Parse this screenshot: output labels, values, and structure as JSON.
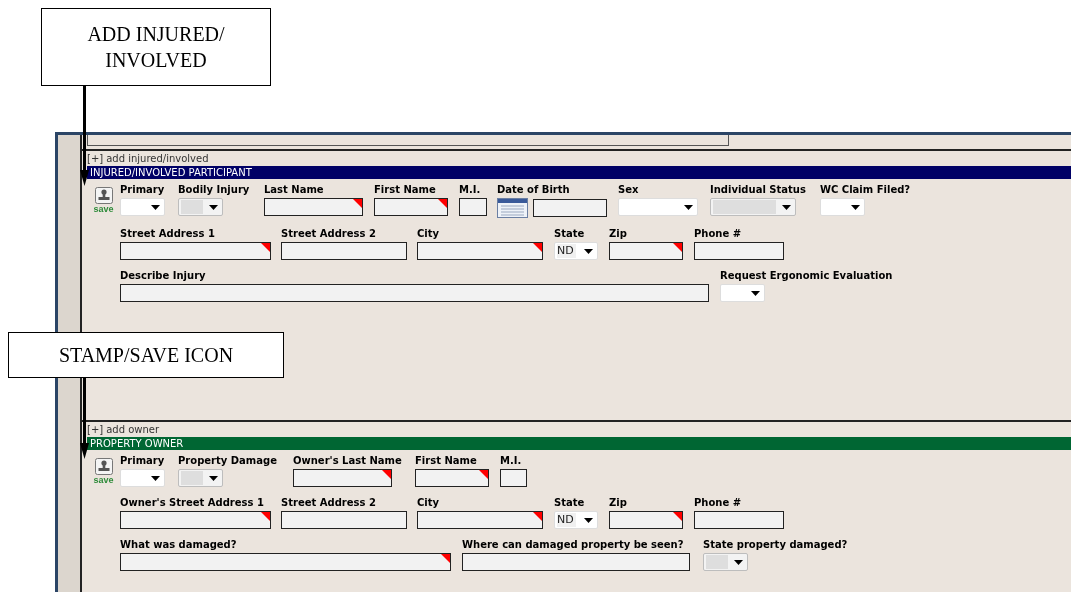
{
  "callouts": [
    {
      "text": "ADD INJURED/ INVOLVED"
    },
    {
      "text": "STAMP/SAVE ICON"
    }
  ],
  "sections": [
    {
      "toggle": "[+]",
      "add_label": "add injured/involved",
      "header": "INJURED/INVOLVED PARTICIPANT",
      "color": "#000066",
      "save_label": "save",
      "rows": [
        {
          "fields": [
            {
              "label": "Primary",
              "kind": "select",
              "required": false,
              "disabled": false
            },
            {
              "label": "Bodily Injury",
              "kind": "select",
              "required": false,
              "disabled": true
            },
            {
              "label": "Last Name",
              "kind": "text",
              "required": true,
              "disabled": false
            },
            {
              "label": "First Name",
              "kind": "text",
              "required": true,
              "disabled": false
            },
            {
              "label": "M.I.",
              "kind": "text",
              "required": false,
              "disabled": false
            },
            {
              "label": "Date of Birth",
              "kind": "date",
              "required": false,
              "disabled": false
            },
            {
              "label": "Sex",
              "kind": "select",
              "required": false,
              "disabled": false
            },
            {
              "label": "Individual Status",
              "kind": "select",
              "required": false,
              "disabled": true
            },
            {
              "label": "WC Claim Filed?",
              "kind": "select",
              "required": false,
              "disabled": false
            }
          ]
        },
        {
          "fields": [
            {
              "label": "Street Address 1",
              "kind": "text",
              "required": true,
              "disabled": false
            },
            {
              "label": "Street Address 2",
              "kind": "text",
              "required": false,
              "disabled": false
            },
            {
              "label": "City",
              "kind": "text",
              "required": true,
              "disabled": false
            },
            {
              "label": "State",
              "kind": "select",
              "required": false,
              "disabled": false,
              "value": "ND"
            },
            {
              "label": "Zip",
              "kind": "text",
              "required": true,
              "disabled": false
            },
            {
              "label": "Phone #",
              "kind": "text",
              "required": false,
              "disabled": false
            }
          ]
        },
        {
          "fields": [
            {
              "label": "Describe Injury",
              "kind": "text",
              "required": false,
              "disabled": false
            },
            {
              "label": "Request Ergonomic Evaluation",
              "kind": "select",
              "required": false,
              "disabled": false
            }
          ]
        }
      ]
    },
    {
      "toggle": "[+]",
      "add_label": "add owner",
      "header": "PROPERTY OWNER",
      "color": "#006633",
      "save_label": "save",
      "rows": [
        {
          "fields": [
            {
              "label": "Primary",
              "kind": "select",
              "required": false,
              "disabled": false
            },
            {
              "label": "Property Damage",
              "kind": "select",
              "required": false,
              "disabled": true
            },
            {
              "label": "Owner's Last Name",
              "kind": "text",
              "required": true,
              "disabled": false
            },
            {
              "label": "First Name",
              "kind": "text",
              "required": true,
              "disabled": false
            },
            {
              "label": "M.I.",
              "kind": "text",
              "required": false,
              "disabled": false
            }
          ]
        },
        {
          "fields": [
            {
              "label": "Owner's Street Address 1",
              "kind": "text",
              "required": true,
              "disabled": false
            },
            {
              "label": "Street Address 2",
              "kind": "text",
              "required": false,
              "disabled": false
            },
            {
              "label": "City",
              "kind": "text",
              "required": true,
              "disabled": false
            },
            {
              "label": "State",
              "kind": "select",
              "required": false,
              "disabled": false,
              "value": "ND"
            },
            {
              "label": "Zip",
              "kind": "text",
              "required": true,
              "disabled": false
            },
            {
              "label": "Phone #",
              "kind": "text",
              "required": false,
              "disabled": false
            }
          ]
        },
        {
          "fields": [
            {
              "label": "What was damaged?",
              "kind": "text",
              "required": true,
              "disabled": false
            },
            {
              "label": "Where can damaged property be seen?",
              "kind": "text",
              "required": false,
              "disabled": false
            },
            {
              "label": "State property damaged?",
              "kind": "select",
              "required": false,
              "disabled": true
            }
          ]
        }
      ]
    }
  ]
}
